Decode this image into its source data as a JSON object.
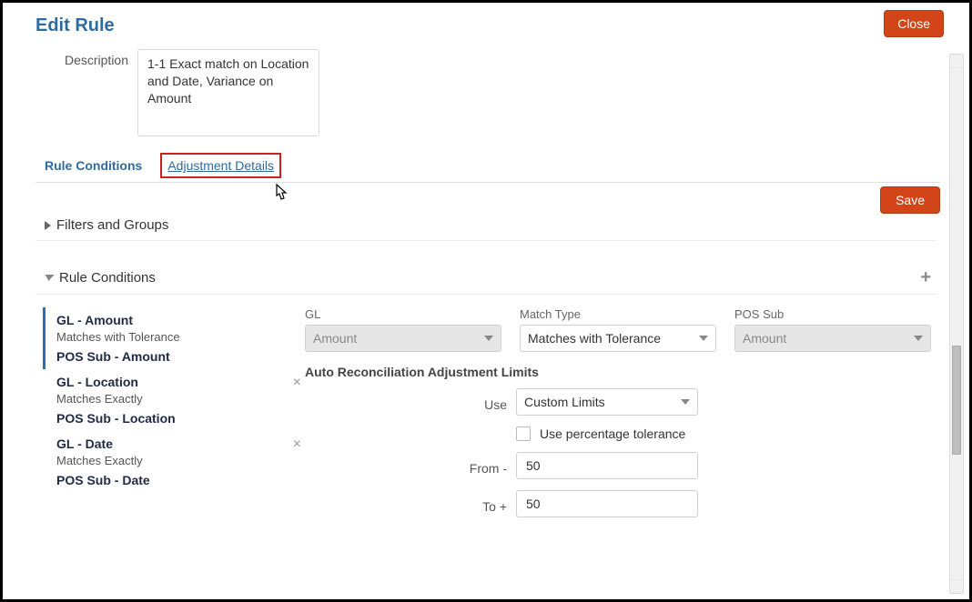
{
  "dialog": {
    "title": "Edit Rule",
    "close_label": "Close"
  },
  "form": {
    "description_label": "Description",
    "description_value": "1-1 Exact match on Location and Date, Variance on Amount"
  },
  "tabs": {
    "conditions": "Rule Conditions",
    "adjustment": "Adjustment Details"
  },
  "actions": {
    "save_label": "Save"
  },
  "sections": {
    "filters_groups": "Filters and Groups",
    "rule_conditions": "Rule Conditions"
  },
  "conditions_list": [
    {
      "line1": "GL   -   Amount",
      "match": "Matches with Tolerance",
      "line3": "POS Sub   -   Amount",
      "deletable": false,
      "selected": true
    },
    {
      "line1": "GL   -   Location",
      "match": "Matches Exactly",
      "line3": "POS Sub   -   Location",
      "deletable": true,
      "selected": false
    },
    {
      "line1": "GL   -   Date",
      "match": "Matches Exactly",
      "line3": "POS Sub   -   Date",
      "deletable": true,
      "selected": false
    }
  ],
  "detail": {
    "gl_label": "GL",
    "gl_value": "Amount",
    "match_type_label": "Match Type",
    "match_type_value": "Matches with Tolerance",
    "pos_sub_label": "POS Sub",
    "pos_sub_value": "Amount",
    "limits_title": "Auto Reconciliation Adjustment Limits",
    "use_label": "Use",
    "use_value": "Custom Limits",
    "pct_label": "Use percentage tolerance",
    "from_label": "From -",
    "from_value": "50",
    "to_label": "To +",
    "to_value": "50"
  }
}
